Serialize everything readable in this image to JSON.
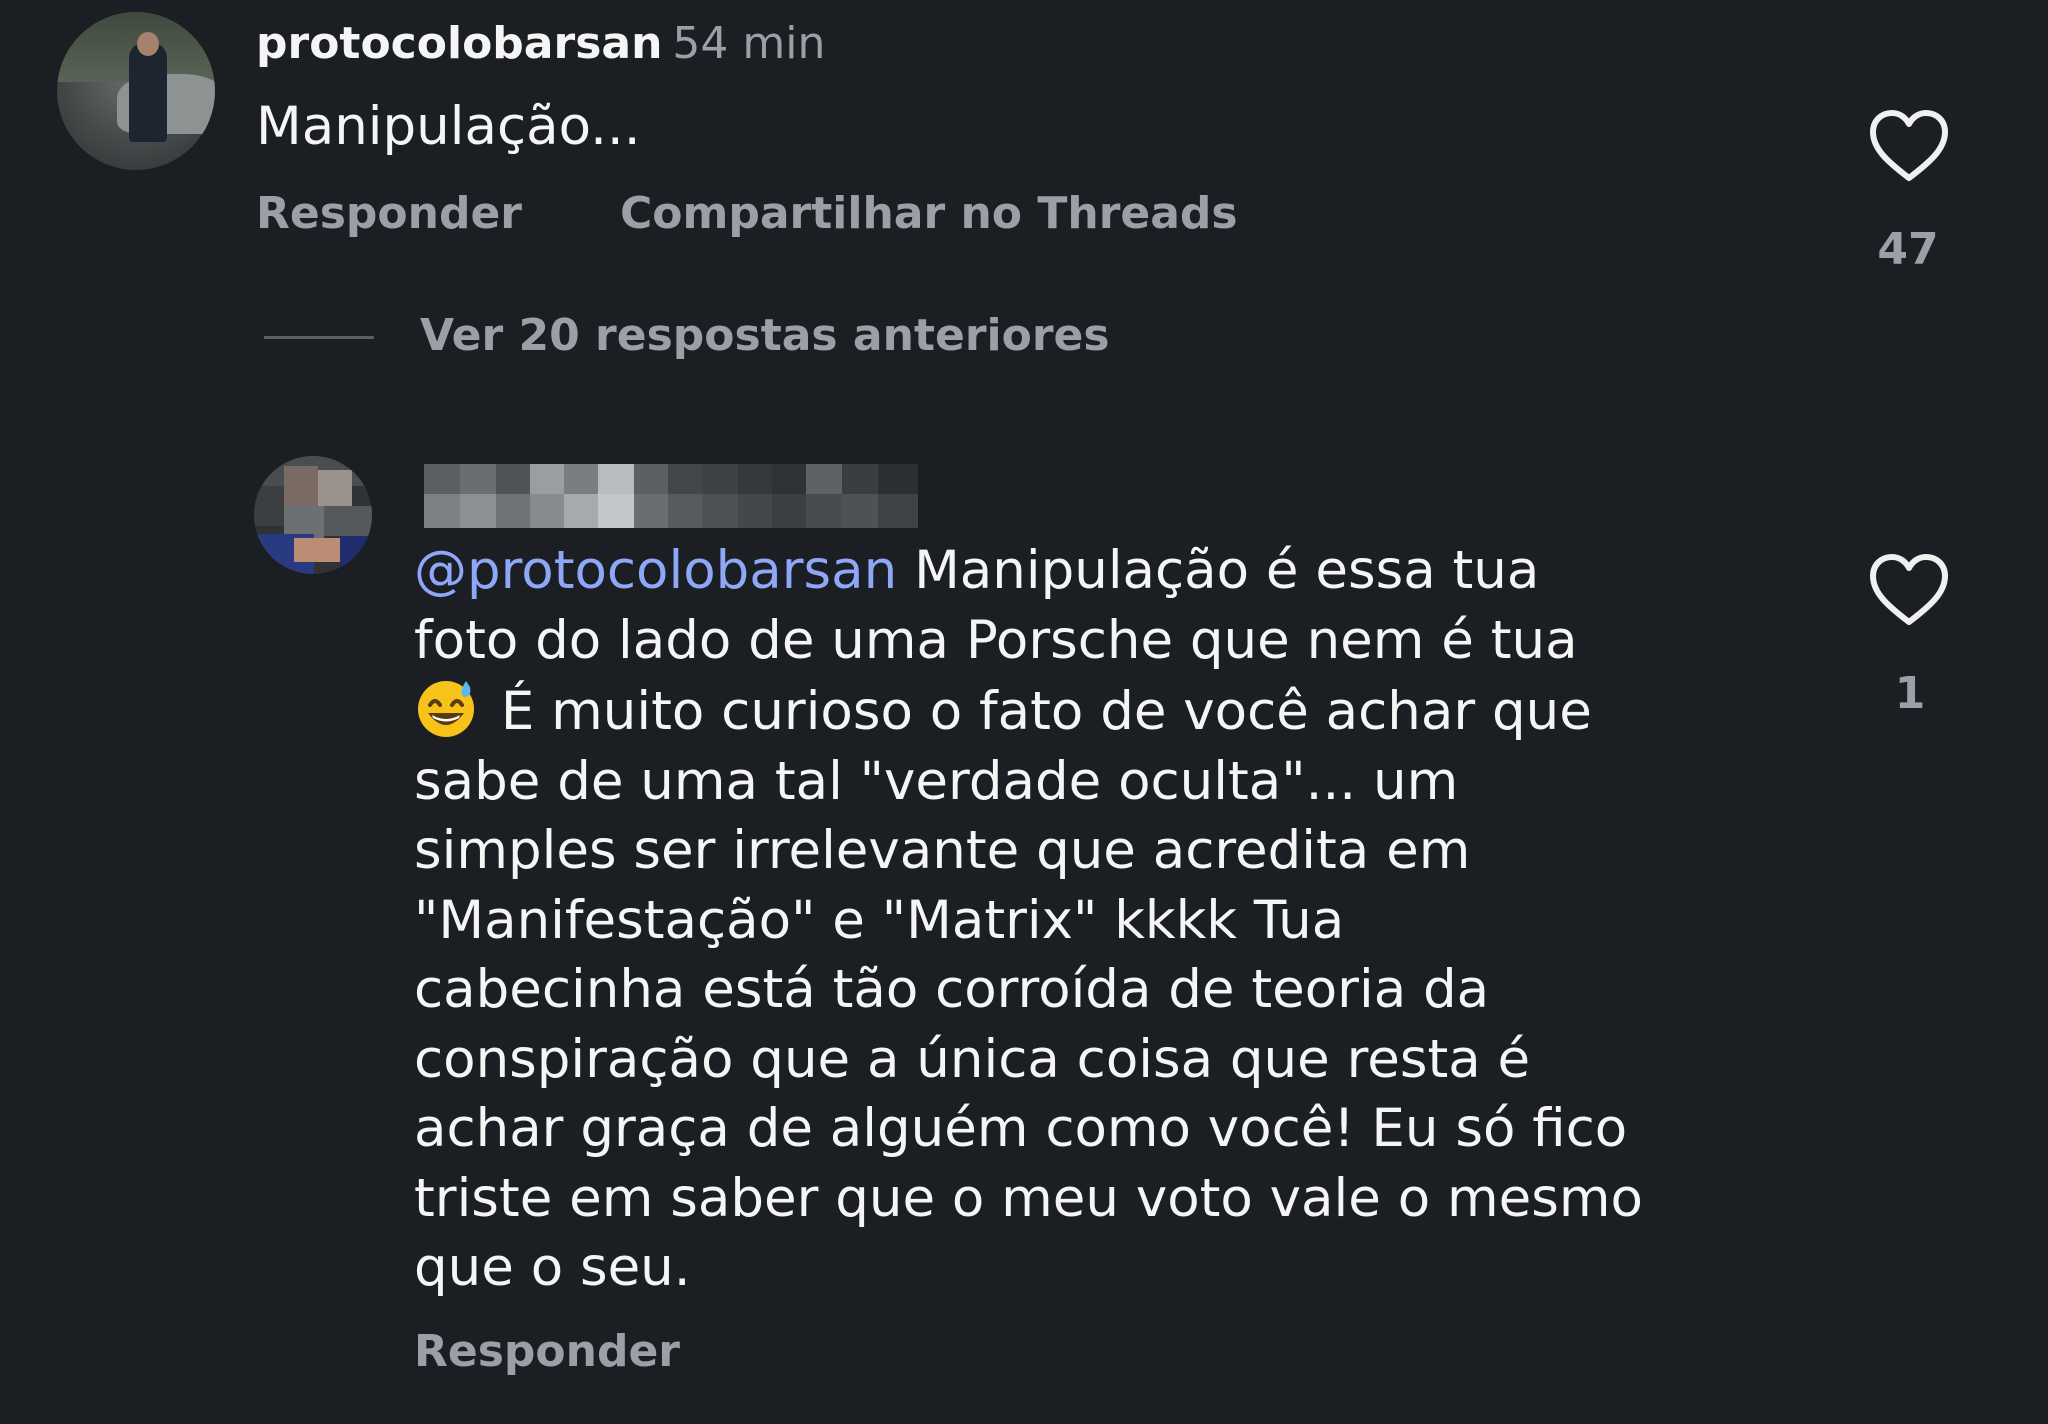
{
  "main_comment": {
    "username": "protocolobarsan",
    "time": "54 min",
    "text": "Manipulação...",
    "reply_label": "Responder",
    "share_label": "Compartilhar no Threads",
    "like_count": "47",
    "view_replies_label": "Ver 20 respostas anteriores"
  },
  "reply_comment": {
    "username_blurred": true,
    "mention": "@protocolobarsan",
    "lines": [
      " Manipulação é essa tua",
      "foto do lado de uma Porsche que nem é tua",
      " É muito curioso o fato de você achar que",
      "sabe de uma tal \"verdade oculta\"... um",
      "simples ser irrelevante que acredita em",
      "\"Manifestação\" e \"Matrix\" kkkk Tua",
      "cabecinha está tão corroída de teoria da",
      "conspiração que a única coisa que resta é",
      "achar graça de alguém como você! Eu só fico",
      "triste em saber que o meu voto vale o mesmo",
      "que o seu."
    ],
    "emoji": "sweat-smile-emoji",
    "reply_label": "Responder",
    "like_count": "1"
  },
  "colors": {
    "background": "#1b1e22",
    "text_primary": "#f5f5f5",
    "text_secondary": "#9aa0a6",
    "mention": "#8ea7f7"
  }
}
